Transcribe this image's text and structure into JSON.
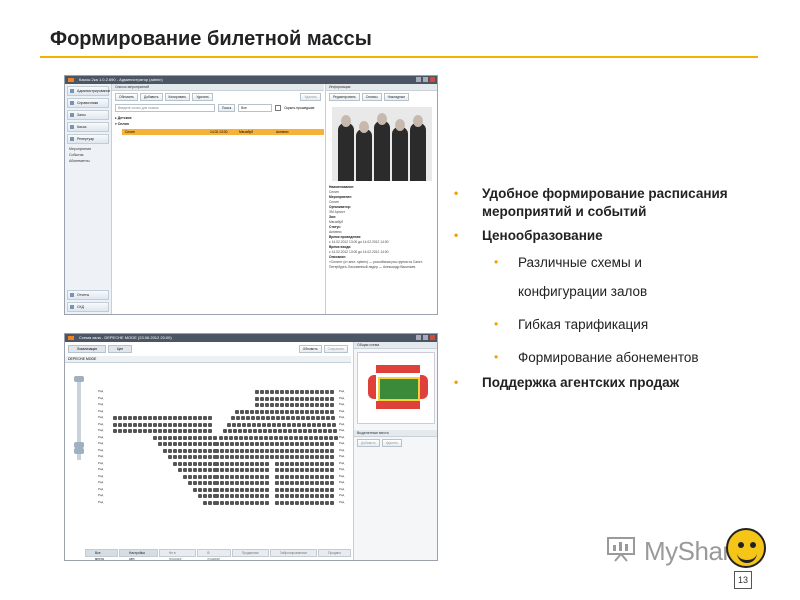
{
  "slide": {
    "title": "Формирование билетной массы",
    "page_number": "13",
    "accent_color": "#f0b400"
  },
  "bullets": [
    {
      "level": 1,
      "text": "Удобное формирование расписания мероприятий и событий"
    },
    {
      "level": 1,
      "text": "Ценообразование"
    },
    {
      "level": 2,
      "text": "Различные схемы и конфигурации залов"
    },
    {
      "level": 2,
      "text": "Гибкая тарификация"
    },
    {
      "level": 2,
      "text": "Формирование абонементов"
    },
    {
      "level": 1,
      "text": "Поддержка агентских продаж"
    }
  ],
  "logo": {
    "text": "MyShared",
    "icon": "presentation-board-icon",
    "smiley_icon": "smiley-icon"
  },
  "screenshot1": {
    "window_title": "Кассы 2ка 1.0.2.690 - Администратор (admin)",
    "sidebar_items": [
      "Администрирование",
      "Справочники",
      "Залы",
      "Касса",
      "Репертуар"
    ],
    "sidebar_subitems": [
      "Мероприятия",
      "События",
      "Абонементы"
    ],
    "sidebar_bottom_items": [
      "Отчеты",
      "СКД"
    ],
    "panel_title": "Список мероприятий",
    "toolbar": [
      "Обновить",
      "Добавить",
      "Копировать",
      "Удалить"
    ],
    "toolbar_right": "Удалить",
    "search_placeholder": "Введите слово для поиска",
    "search_button": "Поиск",
    "filter_value": "Все",
    "hide_past_label": "Скрыть прошедшие",
    "tree_nodes": [
      "Детские",
      "Сплин"
    ],
    "selected_row": {
      "name": "Сплин",
      "date": "14.02.13:00",
      "place": "Мюзибуб",
      "status": "Активно"
    },
    "info_title": "Информация",
    "info_buttons": [
      "Редактировать",
      "Сеансы",
      "Накладные"
    ],
    "info_fields": [
      {
        "label": "Наименование:",
        "value": "Сплин"
      },
      {
        "label": "Мероприятие:",
        "value": "Сплин"
      },
      {
        "label": "Организатор:",
        "value": "ЗМ Артист"
      },
      {
        "label": "Зал:",
        "value": "Мюзибуб"
      },
      {
        "label": "Статус:",
        "value": "Активно"
      },
      {
        "label": "Время проведения:",
        "value": "с 14.02.2012 13:00 до 14.02.2012 14:00"
      },
      {
        "label": "Время входа:",
        "value": "с 14.02.2012 13:00 до 14.02.2012 14:00"
      },
      {
        "label": "Описание:",
        "value": "«Сплин» (от англ. spleen) — российская рок-группа из Санкт-Петербурга. Бессменный лидер — Александр Васильев."
      }
    ]
  },
  "screenshot2": {
    "window_title": "Схема зала - DEPECHE MODE (23.06.2012 20:00)",
    "breadcrumb": [
      "Локализация",
      "Цен"
    ],
    "refresh_button": "Обновить",
    "save_button": "Сохранить",
    "hall_title": "DEPECHE MODE",
    "row_label": "Ряд",
    "side_title": "Общая схема",
    "side_section": "Выделенные места",
    "side_buttons": [
      "Добавить",
      "Удалить"
    ],
    "bottom_tabs": [
      "Все места",
      "Настройка цен",
      "Не в продаже",
      "В продаже",
      "Проданные",
      "Забронированные",
      "Продано"
    ]
  }
}
